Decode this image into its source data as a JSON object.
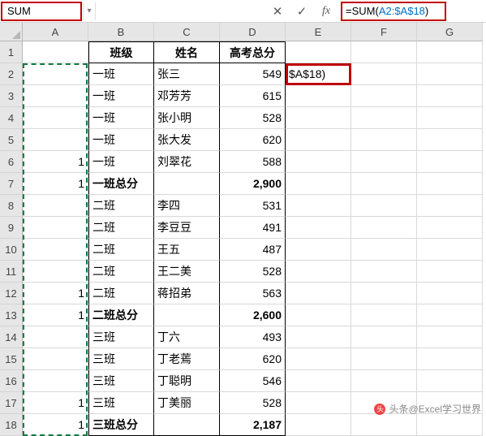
{
  "formula_bar": {
    "name_box": "SUM",
    "cancel": "✕",
    "enter": "✓",
    "fx": "fx",
    "formula_prefix": "=SUM(",
    "formula_ref": "A2:$A$18",
    "formula_suffix": ")"
  },
  "columns": [
    "A",
    "B",
    "C",
    "D",
    "E",
    "F",
    "G"
  ],
  "row_numbers": [
    "1",
    "2",
    "3",
    "4",
    "5",
    "6",
    "7",
    "8",
    "9",
    "10",
    "11",
    "12",
    "13",
    "14",
    "15",
    "16",
    "17",
    "18"
  ],
  "header_row": {
    "b": "班级",
    "c": "姓名",
    "d": "高考总分"
  },
  "rows": [
    {
      "a": "",
      "b": "一班",
      "c": "张三",
      "d": "549",
      "e": "$A$18)",
      "bold": false
    },
    {
      "a": "",
      "b": "一班",
      "c": "邓芳芳",
      "d": "615",
      "bold": false
    },
    {
      "a": "",
      "b": "一班",
      "c": "张小明",
      "d": "528",
      "bold": false
    },
    {
      "a": "",
      "b": "一班",
      "c": "张大发",
      "d": "620",
      "bold": false
    },
    {
      "a": "1",
      "b": "一班",
      "c": "刘翠花",
      "d": "588",
      "bold": false
    },
    {
      "a": "1",
      "b": "一班总分",
      "c": "",
      "d": "2,900",
      "bold": true
    },
    {
      "a": "",
      "b": "二班",
      "c": "李四",
      "d": "531",
      "bold": false
    },
    {
      "a": "",
      "b": "二班",
      "c": "李豆豆",
      "d": "491",
      "bold": false
    },
    {
      "a": "",
      "b": "二班",
      "c": "王五",
      "d": "487",
      "bold": false
    },
    {
      "a": "",
      "b": "二班",
      "c": "王二美",
      "d": "528",
      "bold": false
    },
    {
      "a": "1",
      "b": "二班",
      "c": "蒋招弟",
      "d": "563",
      "bold": false
    },
    {
      "a": "1",
      "b": "二班总分",
      "c": "",
      "d": "2,600",
      "bold": true
    },
    {
      "a": "",
      "b": "三班",
      "c": "丁六",
      "d": "493",
      "bold": false
    },
    {
      "a": "",
      "b": "三班",
      "c": "丁老蔫",
      "d": "620",
      "bold": false
    },
    {
      "a": "",
      "b": "三班",
      "c": "丁聪明",
      "d": "546",
      "bold": false
    },
    {
      "a": "1",
      "b": "三班",
      "c": "丁美丽",
      "d": "528",
      "bold": false
    },
    {
      "a": "1",
      "b": "三班总分",
      "c": "",
      "d": "2,187",
      "bold": true
    }
  ],
  "watermark": "头条@Excel学习世界",
  "chart_data": {
    "type": "table",
    "title": "高考总分",
    "columns": [
      "班级",
      "姓名",
      "高考总分"
    ],
    "records": [
      [
        "一班",
        "张三",
        549
      ],
      [
        "一班",
        "邓芳芳",
        615
      ],
      [
        "一班",
        "张小明",
        528
      ],
      [
        "一班",
        "张大发",
        620
      ],
      [
        "一班",
        "刘翠花",
        588
      ],
      [
        "二班",
        "李四",
        531
      ],
      [
        "二班",
        "李豆豆",
        491
      ],
      [
        "二班",
        "王五",
        487
      ],
      [
        "二班",
        "王二美",
        528
      ],
      [
        "二班",
        "蒋招弟",
        563
      ],
      [
        "三班",
        "丁六",
        493
      ],
      [
        "三班",
        "丁老蔫",
        620
      ],
      [
        "三班",
        "丁聪明",
        546
      ],
      [
        "三班",
        "丁美丽",
        528
      ]
    ],
    "subtotals": {
      "一班总分": 2900,
      "二班总分": 2600,
      "三班总分": 2187
    }
  }
}
